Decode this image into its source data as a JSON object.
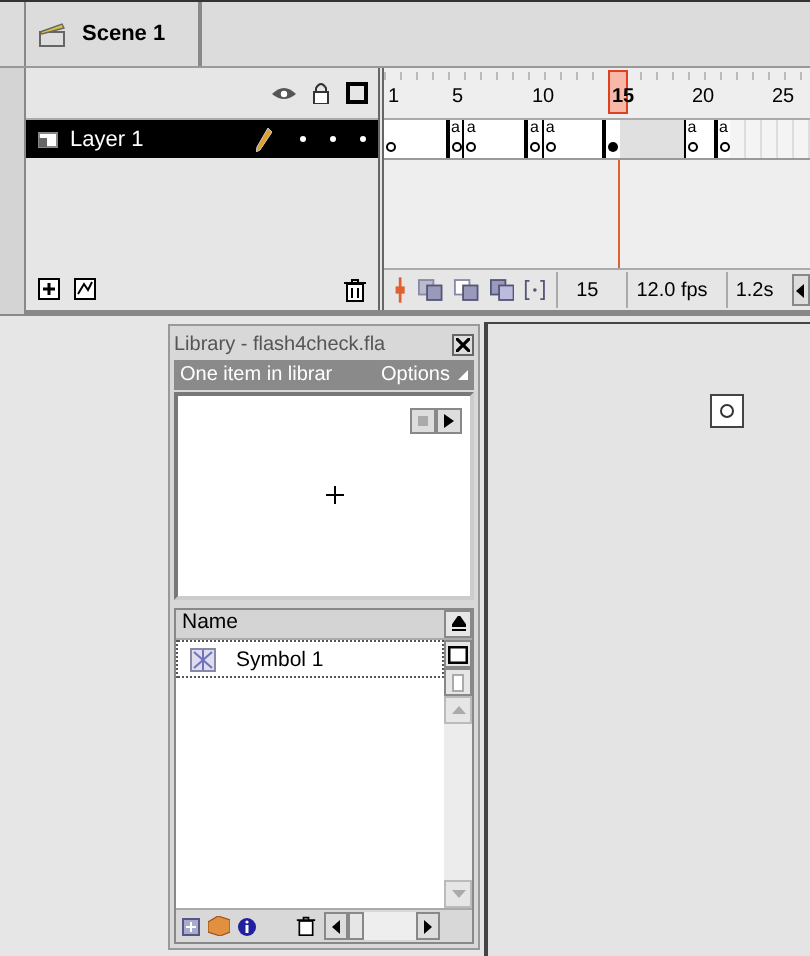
{
  "scene_bar": {
    "scene": "Scene 1"
  },
  "timeline": {
    "ruler": [
      {
        "label": "1",
        "selected": false
      },
      {
        "label": "5",
        "selected": false
      },
      {
        "label": "10",
        "selected": false
      },
      {
        "label": "15",
        "selected": true
      },
      {
        "label": "20",
        "selected": false
      },
      {
        "label": "25",
        "selected": false
      }
    ],
    "layers": [
      {
        "name": "Layer 1",
        "selected": true
      }
    ],
    "frames": [
      {
        "kind": "blank-key"
      },
      {
        "kind": "blank"
      },
      {
        "kind": "blank"
      },
      {
        "kind": "blank-end"
      },
      {
        "kind": "action-key",
        "mark": "a"
      },
      {
        "kind": "action-key",
        "mark": "a"
      },
      {
        "kind": "blank"
      },
      {
        "kind": "blank"
      },
      {
        "kind": "blank-end"
      },
      {
        "kind": "action-key",
        "mark": "a"
      },
      {
        "kind": "action-key",
        "mark": "a"
      },
      {
        "kind": "blank"
      },
      {
        "kind": "blank"
      },
      {
        "kind": "blank-end"
      },
      {
        "kind": "filled-key"
      },
      {
        "kind": "tween"
      },
      {
        "kind": "tween"
      },
      {
        "kind": "tween"
      },
      {
        "kind": "tween"
      },
      {
        "kind": "action-key",
        "mark": "a"
      },
      {
        "kind": "blank-end"
      },
      {
        "kind": "action-key",
        "mark": "a"
      }
    ],
    "status": {
      "current_frame": "15",
      "frame_rate": "12.0 fps",
      "elapsed": "1.2s"
    }
  },
  "library": {
    "title": "Library - flash4check.fla",
    "item_count": "One item in librar",
    "options": "Options",
    "column": "Name",
    "items": [
      {
        "name": "Symbol 1",
        "selected": true
      }
    ]
  }
}
